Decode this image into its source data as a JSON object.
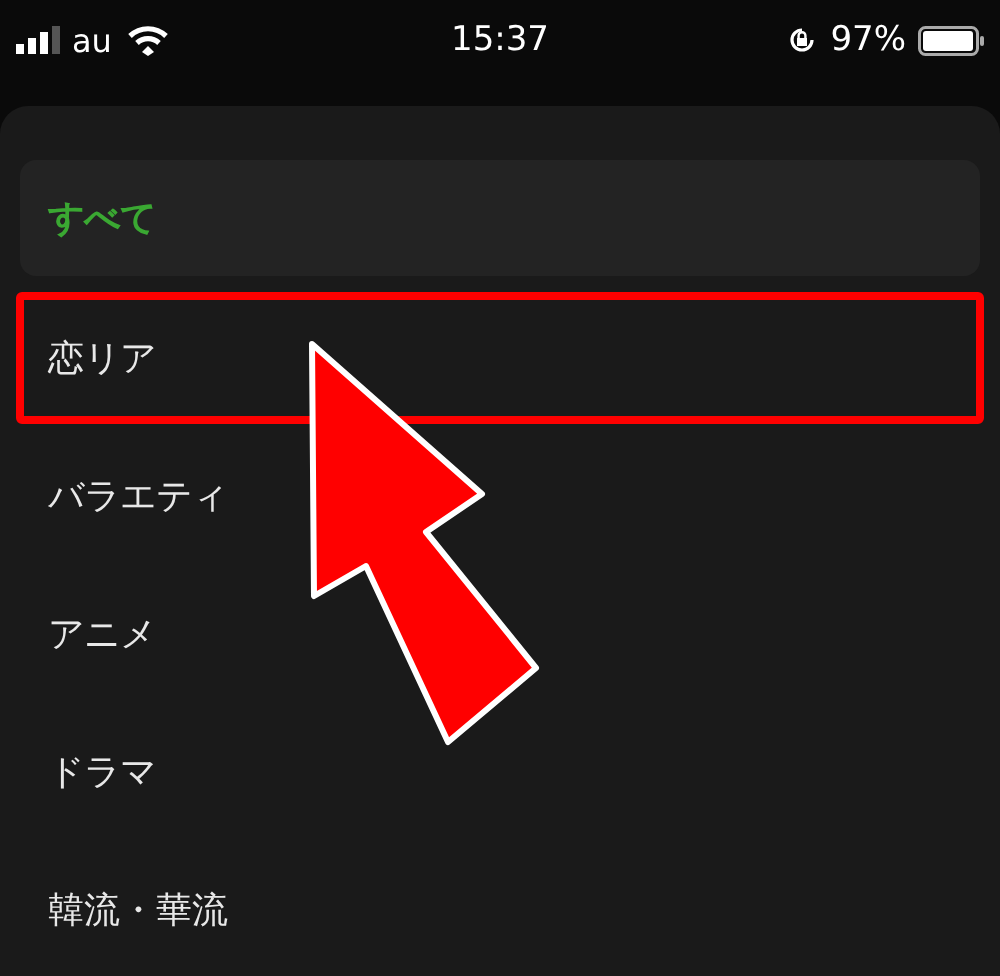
{
  "status_bar": {
    "carrier": "au",
    "time": "15:37",
    "battery": "97%"
  },
  "menu": {
    "items": [
      {
        "label": "すべて",
        "selected": true,
        "highlighted": false
      },
      {
        "label": "恋リア",
        "selected": false,
        "highlighted": true
      },
      {
        "label": "バラエティ",
        "selected": false,
        "highlighted": false
      },
      {
        "label": "アニメ",
        "selected": false,
        "highlighted": false
      },
      {
        "label": "ドラマ",
        "selected": false,
        "highlighted": false
      },
      {
        "label": "韓流・華流",
        "selected": false,
        "highlighted": false
      }
    ]
  }
}
